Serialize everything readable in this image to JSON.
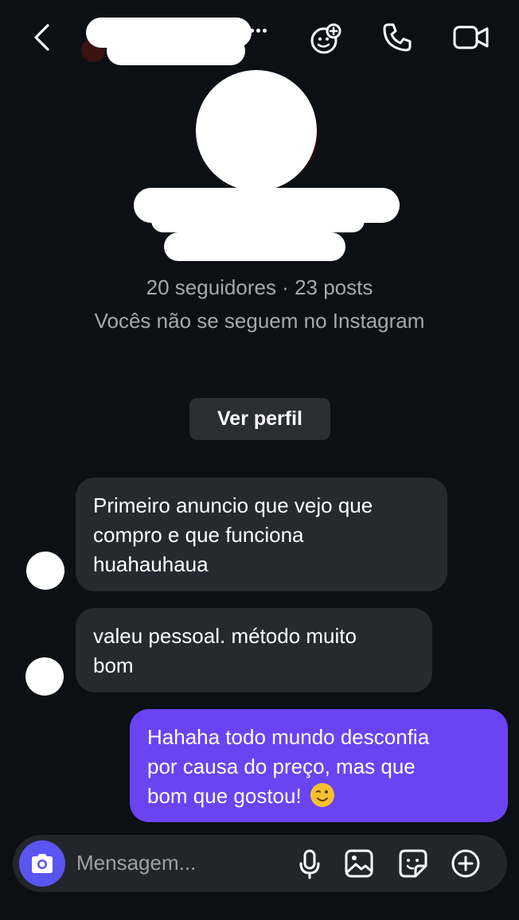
{
  "header": {
    "back_icon": "chevron-left-icon",
    "username_redacted": "",
    "actions": [
      "add-effect-icon",
      "phone-icon",
      "video-icon"
    ]
  },
  "profile": {
    "stats": "20 seguidores · 23 posts",
    "relation": "Vocês não se seguem no Instagram",
    "view_profile_label": "Ver perfil"
  },
  "messages": [
    {
      "direction": "incoming",
      "lines": [
        "Primeiro anuncio que vejo que",
        "compro e que funciona",
        "huahauhaua"
      ]
    },
    {
      "direction": "incoming",
      "lines": [
        "valeu pessoal. método muito",
        "bom"
      ]
    },
    {
      "direction": "outgoing",
      "lines": [
        "Hahaha todo mundo desconfia",
        "por causa do preço, mas que",
        "bom que gostou!"
      ],
      "emoji": "winking-face"
    }
  ],
  "composer": {
    "placeholder": "Mensagem...",
    "icons": [
      "camera-icon",
      "microphone-icon",
      "image-icon",
      "sticker-icon",
      "plus-icon"
    ]
  },
  "colors": {
    "background": "#0c1014",
    "incoming_bubble": "#262a30",
    "outgoing_bubble": "#6a44f2",
    "camera_button": "#5b54f0"
  }
}
